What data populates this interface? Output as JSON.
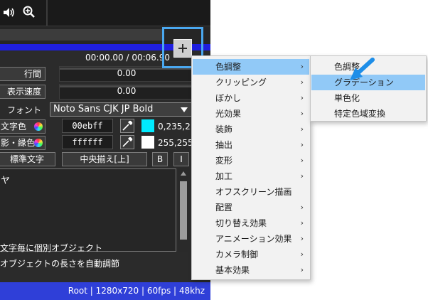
{
  "panel": {
    "timecode": "00:00.00 / 00:06.90",
    "progress_fraction": 1.0,
    "rows": {
      "line_spacing": {
        "label": "行間",
        "value": "0.00"
      },
      "display_speed": {
        "label": "表示速度",
        "value": "0.00"
      },
      "font": {
        "label": "フォント",
        "value": "Noto Sans CJK JP Bold"
      },
      "text_color": {
        "label": "文字色",
        "hex": "00ebff",
        "rgb": "0,235,2",
        "swatch": "#00ebff"
      },
      "shadow_color": {
        "label": "影・縁色",
        "hex": "ffffff",
        "rgb": "255,255",
        "swatch": "#ffffff"
      }
    },
    "style_buttons": {
      "standard": "標準文字",
      "align": "中央揃え[上]",
      "bold": "B",
      "italic": "I"
    },
    "textarea": {
      "text": "ヤ"
    },
    "checkboxes": [
      "文字毎に個別オブジェクト",
      "オブジェクトの長さを自動調節"
    ],
    "status": "Root | 1280x720 | 60fps | 48khz"
  },
  "menu_main": {
    "items": [
      {
        "label": "色調整",
        "submenu": true,
        "selected": true
      },
      {
        "label": "クリッピング",
        "submenu": true
      },
      {
        "label": "ぼかし",
        "submenu": true
      },
      {
        "label": "光効果",
        "submenu": true
      },
      {
        "label": "装飾",
        "submenu": true
      },
      {
        "label": "抽出",
        "submenu": true
      },
      {
        "label": "変形",
        "submenu": true
      },
      {
        "label": "加工",
        "submenu": true
      },
      {
        "label": "オフスクリーン描画",
        "submenu": false
      },
      {
        "label": "配置",
        "submenu": true
      },
      {
        "label": "切り替え効果",
        "submenu": true
      },
      {
        "label": "アニメーション効果",
        "submenu": true
      },
      {
        "label": "カメラ制御",
        "submenu": true
      },
      {
        "label": "基本効果",
        "submenu": true
      }
    ],
    "chevron": "›"
  },
  "menu_sub": {
    "items": [
      {
        "label": "色調整"
      },
      {
        "label": "グラデーション",
        "selected": true
      },
      {
        "label": "単色化"
      },
      {
        "label": "特定色域変換"
      }
    ]
  },
  "colors": {
    "highlight": "#4aa8f0",
    "menu_selected": "#91c9f7",
    "status_bar": "#2f3fd8",
    "progress": "#1f1fe0"
  },
  "icons": [
    "volume-icon",
    "zoom-in-icon",
    "plus-icon",
    "eyedropper-icon",
    "color-wheel-icon",
    "pointer-arrow-icon"
  ]
}
